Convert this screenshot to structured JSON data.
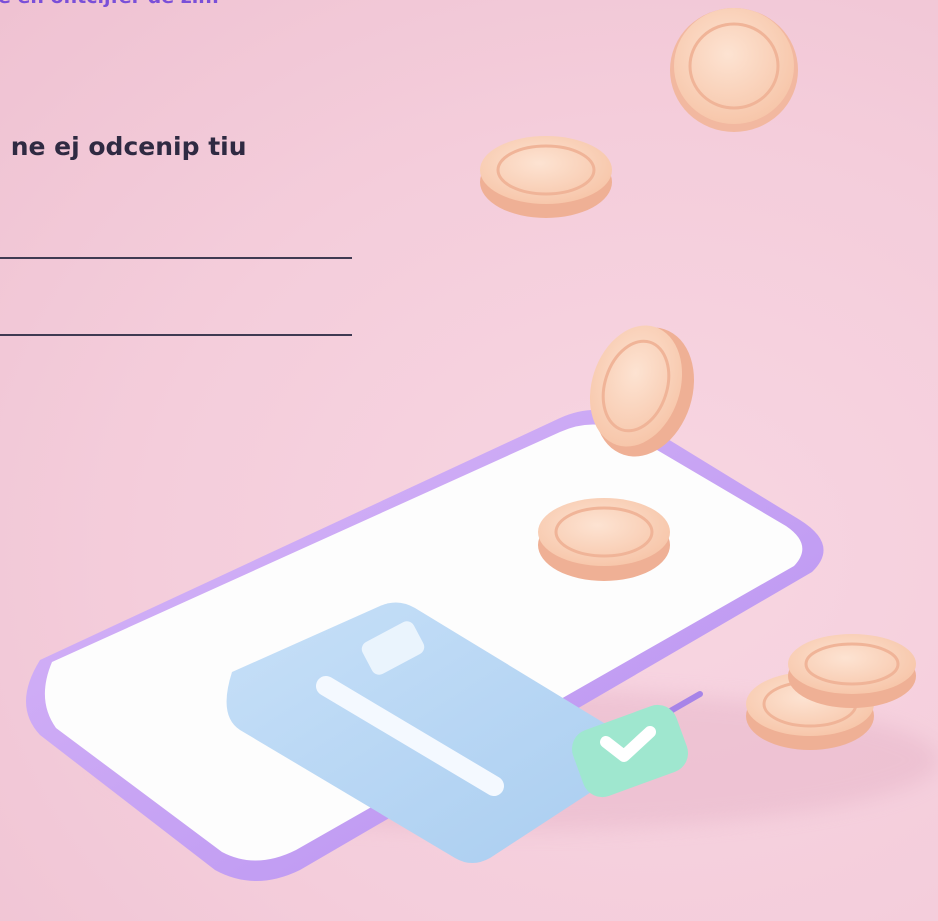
{
  "instruction": {
    "text": "e en ontcijfer de zin."
  },
  "puzzle": {
    "scrambled_text": ": ne ej odcenip tiu"
  },
  "answer_lines": {
    "count": 2
  },
  "colors": {
    "background": "#f4cddb",
    "instruction_text": "#7a4fd8",
    "puzzle_text": "#2f2a42",
    "coin": "#f7c9ad",
    "phone_frame": "#c9a6f2",
    "card": "#b9d8f4",
    "check_badge": "#9fe7cf"
  },
  "illustration": {
    "icons": [
      "phone-icon",
      "credit-card-icon",
      "check-badge-icon",
      "coin-icon"
    ]
  }
}
